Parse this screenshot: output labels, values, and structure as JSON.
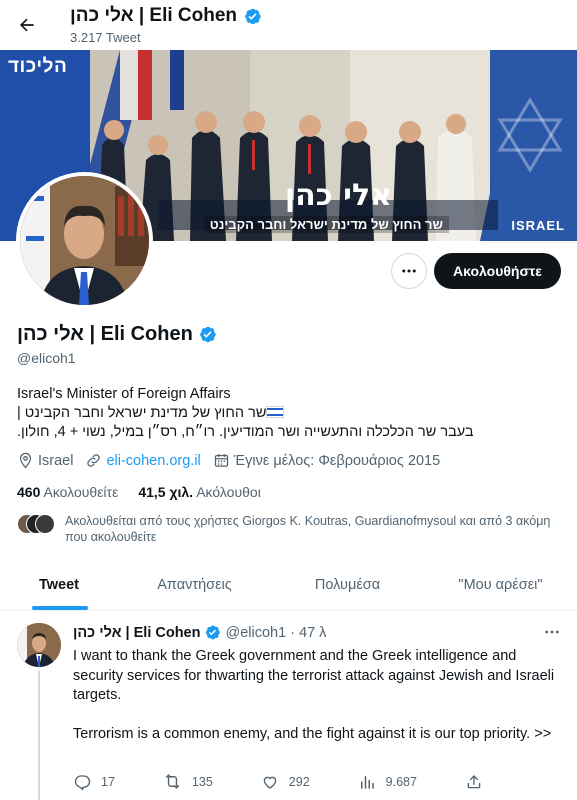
{
  "header": {
    "title": "אלי כהן | Eli Cohen",
    "tweet_count": "3.217 Tweet"
  },
  "banner": {
    "logo_text": "הליכוד",
    "name_text": "אלי כהן",
    "caption": "שר החוץ של מדינת ישראל וחבר הקבינט",
    "israel_text": "ISRAEL",
    "colors": {
      "navy": "#16315f",
      "blue": "#1f4fa8"
    }
  },
  "actions": {
    "more_icon": "more-horizontal-icon",
    "follow_label": "Ακολουθήστε"
  },
  "profile": {
    "name": "אלי כהן | Eli Cohen",
    "handle": "@elicoh1",
    "bio_line1": "Israel's Minister of Foreign Affairs",
    "bio_line2": "שר החוץ של מדינת ישראל וחבר הקבינט |",
    "bio_line3": "בעבר שר הכלכלה והתעשייה ושר המודיעין. רו״ח, רס״ן במיל, נשוי + 4, חולון.",
    "location": "Israel",
    "website": "eli-cohen.org.il",
    "joined": "Έγινε μέλος: Φεβρουάριος 2015",
    "following_count": "460",
    "following_label": "Ακολουθείτε",
    "followers_count": "41,5 χιλ.",
    "followers_label": "Ακόλουθοι",
    "followed_by": "Ακολουθείται από τους χρήστες Giorgos K. Koutras, Guardianofmysoul και από 3 ακόμη που ακολουθείτε"
  },
  "tabs": [
    {
      "label": "Tweet",
      "active": true
    },
    {
      "label": "Απαντήσεις",
      "active": false
    },
    {
      "label": "Πολυμέσα",
      "active": false
    },
    {
      "label": "\"Μου αρέσει\"",
      "active": false
    }
  ],
  "tweet": {
    "name": "אלי כהן | Eli Cohen",
    "handle": "@elicoh1",
    "separator": "·",
    "time": "47 λ",
    "text_p1": "I want to thank the Greek government and the Greek intelligence and security services for thwarting the terrorist attack against Jewish and Israeli targets.",
    "text_p2": "Terrorism is a common enemy, and the fight against it is our top priority. >>",
    "replies": "17",
    "retweets": "135",
    "likes": "292",
    "views": "9.687"
  },
  "colors": {
    "accent": "#1d9bf0",
    "text": "#0f1419",
    "muted": "#536471",
    "follow_bg": "#0f1419"
  }
}
